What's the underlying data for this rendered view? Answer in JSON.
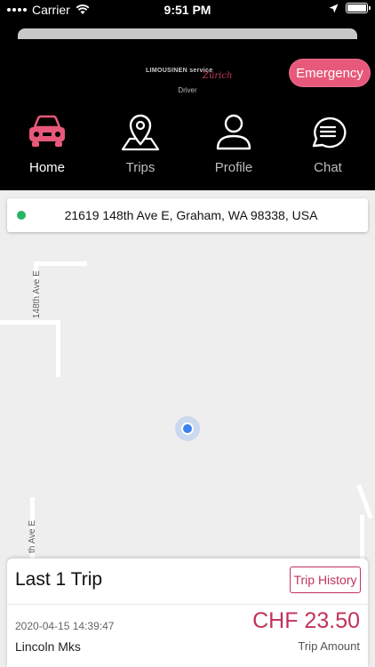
{
  "status_bar": {
    "carrier": "Carrier",
    "time": "9:51 PM"
  },
  "header": {
    "logo": {
      "line1": "LIMOUSINEN service",
      "script": "Zürich",
      "subtitle": "Driver"
    },
    "emergency_label": "Emergency"
  },
  "nav": {
    "items": [
      {
        "label": "Home",
        "icon": "car-icon",
        "active": true
      },
      {
        "label": "Trips",
        "icon": "map-pin-icon",
        "active": false
      },
      {
        "label": "Profile",
        "icon": "user-icon",
        "active": false
      },
      {
        "label": "Chat",
        "icon": "chat-icon",
        "active": false
      }
    ]
  },
  "map": {
    "address": "21619 148th Ave E, Graham, WA 98338, USA",
    "street_labels": [
      "148th Ave E",
      "th Ave E"
    ]
  },
  "trip": {
    "title": "Last 1 Trip",
    "history_label": "Trip History",
    "date": "2020-04-15 14:39:47",
    "vehicle": "Lincoln Mks",
    "amount": "CHF 23.50",
    "amount_label": "Trip Amount"
  },
  "colors": {
    "accent": "#c2335a",
    "emergency": "#e8587a",
    "status_ok": "#28b463",
    "location": "#3c82f0"
  }
}
